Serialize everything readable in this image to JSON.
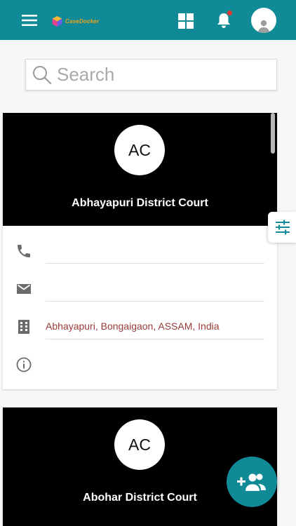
{
  "header": {
    "brand_name": "CaseDocker",
    "colors": {
      "primary": "#0f8a96",
      "notification_dot": "#e53935",
      "brand_text": "#f0a419"
    }
  },
  "search": {
    "placeholder": "Search"
  },
  "courts": [
    {
      "initials": "AC",
      "name": "Abhayapuri District Court",
      "phone": "",
      "email": "",
      "address": "Abhayapuri, Bongaigaon, ASSAM, India",
      "info": ""
    },
    {
      "initials": "AC",
      "name": "Abohar District Court"
    }
  ],
  "icons": {
    "menu": "menu-icon",
    "grid": "grid-icon",
    "bell": "bell-icon",
    "phone": "phone-icon",
    "email": "email-icon",
    "building": "building-icon",
    "info": "info-icon",
    "filter": "filter-icon",
    "add_group": "group-add-icon"
  }
}
